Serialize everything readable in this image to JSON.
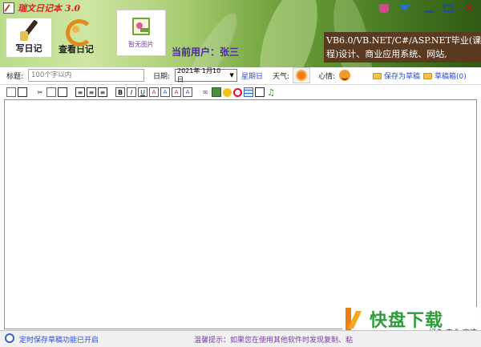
{
  "window": {
    "title": "瑞文日记本 3.0",
    "controls": [
      "skin-icon",
      "dropdown-icon",
      "minimize-icon",
      "maximize-icon",
      "close-icon"
    ]
  },
  "nav": {
    "write_label": "写日记",
    "view_label": "查看日记"
  },
  "photo": {
    "label": "暂无图片"
  },
  "user": {
    "current": "当前用户：张三"
  },
  "marquee": {
    "line1": "VB6.0/VB.NET/C#/ASP.NET毕业(课",
    "line2": "程)设计、商业应用系统、网站,"
  },
  "form": {
    "title_label": "标题:",
    "title_placeholder": "100个字以内",
    "date_label": "日期:",
    "date_value": "2021年 1月10日",
    "weekday": "星期日",
    "weather_label": "天气:",
    "mood_label": "心情:",
    "save_draft": "保存为草稿",
    "drafts": "草稿箱(0)"
  },
  "toolbar": {
    "icons": [
      "new-doc-icon",
      "template-icon",
      "cut-icon",
      "copy-icon",
      "paste-icon",
      "align-left-icon",
      "align-center-icon",
      "align-right-icon",
      "bold-icon",
      "italic-icon",
      "underline-icon",
      "font-color-icon",
      "font-size-icon",
      "font-bg-icon",
      "font-style-icon",
      "link-icon",
      "image-icon",
      "emoticon-icon",
      "flash-icon",
      "table-icon",
      "media-icon",
      "music-icon"
    ],
    "bold": "B",
    "italic": "I",
    "underline": "U"
  },
  "watermark": {
    "brand": "快盘下载",
    "tagline": "绿色·安全·高速"
  },
  "status": {
    "left": "定时保存草稿功能已开启",
    "right": "温馨提示：如果您在使用其他软件时发现复制、粘"
  },
  "colors": {
    "accent_blue": "#2a4bd0",
    "title_red": "#d22222",
    "user_purple": "#4b2aa0",
    "banner_brown": "#5a3b21"
  }
}
